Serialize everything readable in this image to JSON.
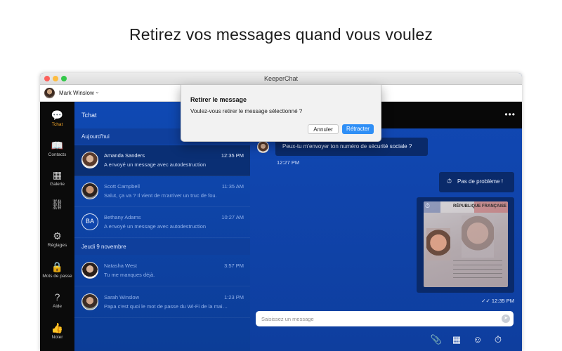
{
  "headline": "Retirez vos messages quand vous voulez",
  "window": {
    "title": "KeeperChat"
  },
  "user": {
    "name": "Mark Winslow",
    "caret": "⌄"
  },
  "sidebar": {
    "items": [
      {
        "label": "Tchat",
        "icon": "chat-bubble-icon",
        "glyph": "💬"
      },
      {
        "label": "Contacts",
        "icon": "book-icon",
        "glyph": "📖"
      },
      {
        "label": "Galerie",
        "icon": "grid-icon",
        "glyph": "▦"
      },
      {
        "label": "",
        "icon": "link-icon",
        "glyph": "⛓"
      },
      {
        "label": "Réglages",
        "icon": "gear-icon",
        "glyph": "⚙"
      },
      {
        "label": "Mots de passe",
        "icon": "lock-icon",
        "glyph": "🔒"
      },
      {
        "label": "Aide",
        "icon": "help-icon",
        "glyph": "?"
      },
      {
        "label": "Noter",
        "icon": "thumbs-up-icon",
        "glyph": "👍"
      }
    ]
  },
  "list": {
    "title": "Tchat",
    "sections": [
      {
        "label": "Aujourd'hui"
      },
      {
        "label": "Jeudi 9 novembre"
      }
    ],
    "rows": [
      {
        "name": "Amanda Sanders",
        "time": "12:35 PM",
        "message": "A envoyé un message avec autodestruction",
        "initials": ""
      },
      {
        "name": "Scott Campbell",
        "time": "11:35 AM",
        "message": "Salut, ça va ? Il vient de m'arriver un truc de fou.",
        "initials": ""
      },
      {
        "name": "Bethany Adams",
        "time": "10:27 AM",
        "message": "A envoyé un message avec autodestruction",
        "initials": "BA"
      },
      {
        "name": "Natasha West",
        "time": "3:57 PM",
        "message": "Tu me manques déjà.",
        "initials": ""
      },
      {
        "name": "Sarah Winslow",
        "time": "1:23 PM",
        "message": "Papa c'est quoi le mot de passe du Wi-Fi de la mai…",
        "initials": ""
      }
    ]
  },
  "chat": {
    "menu_glyph": "•••",
    "incoming": {
      "text": "Peux-tu m'envoyer ton numéro de sécurité sociale ?",
      "time": "12:27 PM"
    },
    "outgoing": {
      "text": "Pas de problème !",
      "timer_glyph": "⏱"
    },
    "attachment": {
      "title": "RÉPUBLIQUE FRANÇAISE",
      "timer_glyph": "⏱"
    },
    "sent": {
      "check_glyph": "✓✓",
      "time": "12:35 PM"
    },
    "input_placeholder": "Saisissez un message",
    "send_glyph": "➤",
    "tools": [
      {
        "icon": "paperclip-icon",
        "glyph": "📎"
      },
      {
        "icon": "grid-icon",
        "glyph": "▦"
      },
      {
        "icon": "emoji-icon",
        "glyph": "☺"
      },
      {
        "icon": "timer-icon",
        "glyph": "⏱"
      }
    ]
  },
  "dialog": {
    "title": "Retirer le message",
    "body": "Voulez-vous retirer le message sélectionné ?",
    "cancel_label": "Annuler",
    "confirm_label": "Rétracter"
  },
  "colors": {
    "accent_active": "#f0a52a",
    "primary_button": "#2f8ff6",
    "chat_background": "#1148b4",
    "sidebar_background": "#0b0b0b"
  }
}
